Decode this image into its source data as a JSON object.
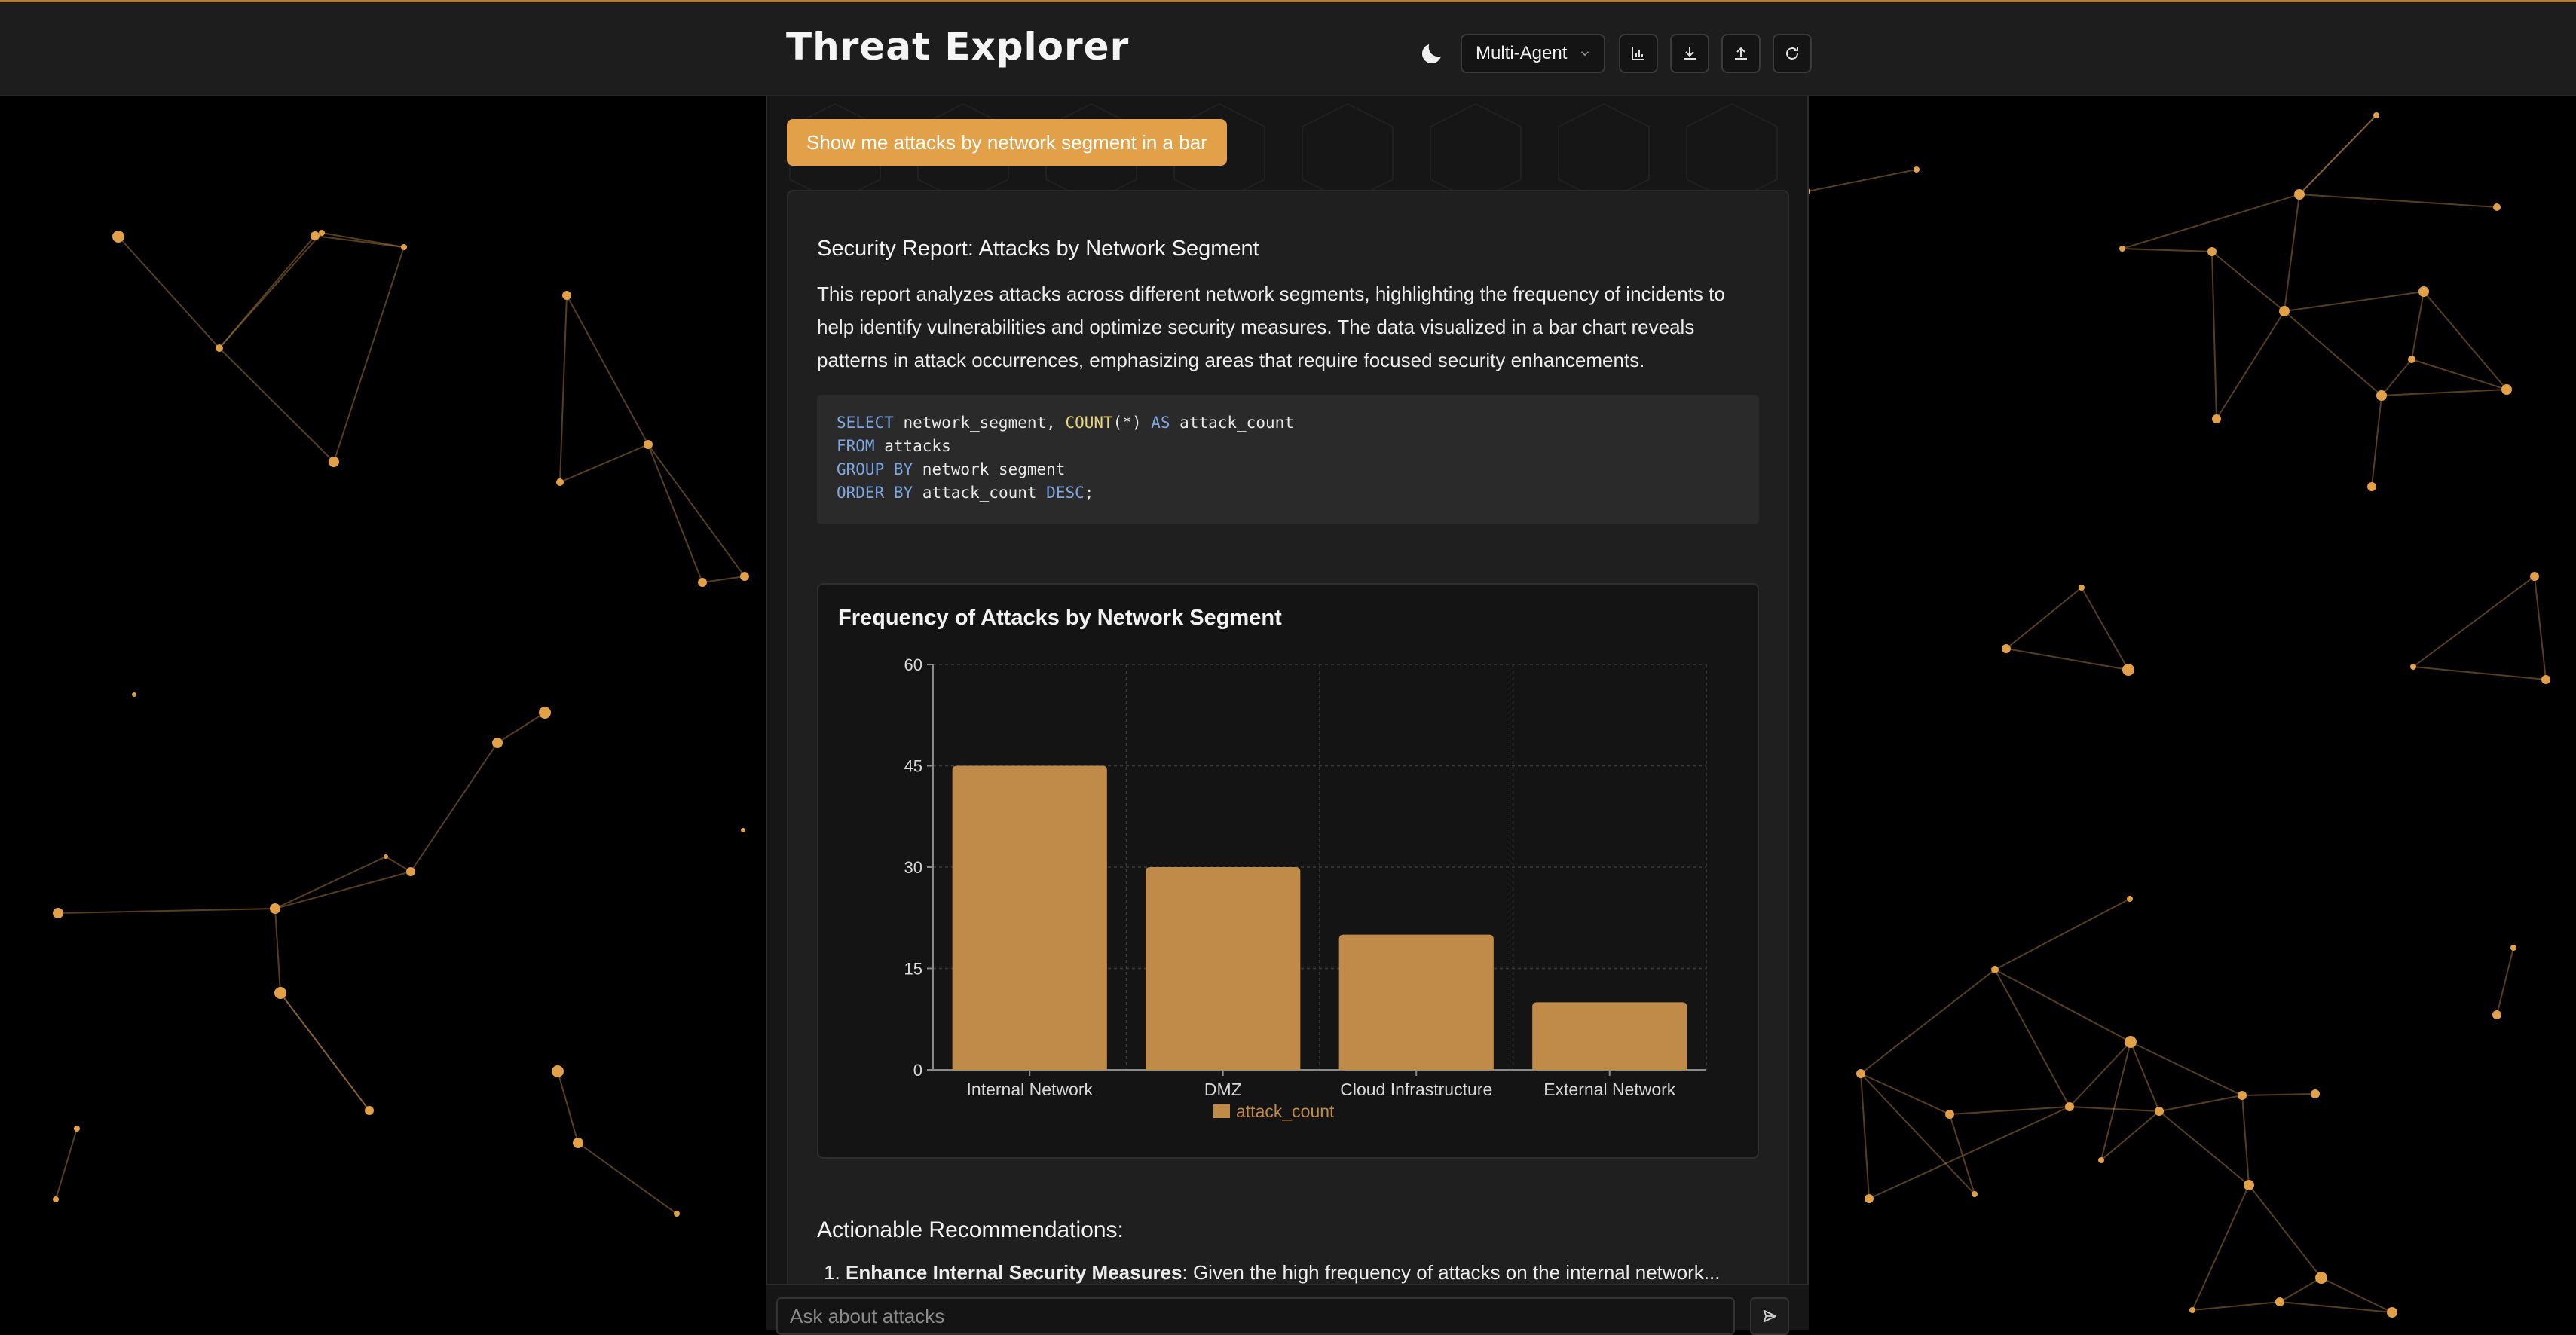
{
  "header": {
    "title": "Threat Explorer",
    "mode_select": {
      "value": "Multi-Agent"
    },
    "icons": [
      "moon-icon",
      "bar-chart-icon",
      "download-icon",
      "upload-icon",
      "refresh-icon"
    ]
  },
  "query": {
    "text": "Show me attacks by network segment in a bar"
  },
  "report": {
    "title": "Security Report: Attacks by Network Segment",
    "description": "This report analyzes attacks across different network segments, highlighting the frequency of incidents to help identify vulnerabilities and optimize security measures. The data visualized in a bar chart reveals patterns in attack occurrences, emphasizing areas that require focused security enhancements.",
    "sql": {
      "line1": {
        "kw": "SELECT",
        "a": " network_segment, ",
        "fn": "COUNT",
        "b": "(*) ",
        "kw2": "AS",
        "c": " attack_count"
      },
      "line2": {
        "kw": "FROM",
        "a": " attacks"
      },
      "line3": {
        "kw": "GROUP BY",
        "a": " network_segment"
      },
      "line4": {
        "kw": "ORDER BY",
        "a": " attack_count ",
        "kw2": "DESC",
        "c": ";"
      }
    },
    "recommendations": {
      "title": "Actionable Recommendations:",
      "items": [
        {
          "bold": "Enhance Internal Security Measures",
          "text": ": Given the high frequency of attacks on the internal network..."
        }
      ]
    }
  },
  "chart_data": {
    "type": "bar",
    "title": "Frequency of Attacks by Network Segment",
    "categories": [
      "Internal Network",
      "DMZ",
      "Cloud Infrastructure",
      "External Network"
    ],
    "series": [
      {
        "name": "attack_count",
        "values": [
          45,
          30,
          20,
          10
        ]
      }
    ],
    "ylim": [
      0,
      60
    ],
    "yticks": [
      0,
      15,
      30,
      45,
      60
    ],
    "grid": true,
    "legend": "bottom-center",
    "bar_color": "#c08a48"
  },
  "input": {
    "placeholder": "Ask about attacks"
  },
  "colors": {
    "accent": "#e2a048",
    "background": "#000000",
    "panel": "#161616",
    "card": "#1f1f1f"
  }
}
